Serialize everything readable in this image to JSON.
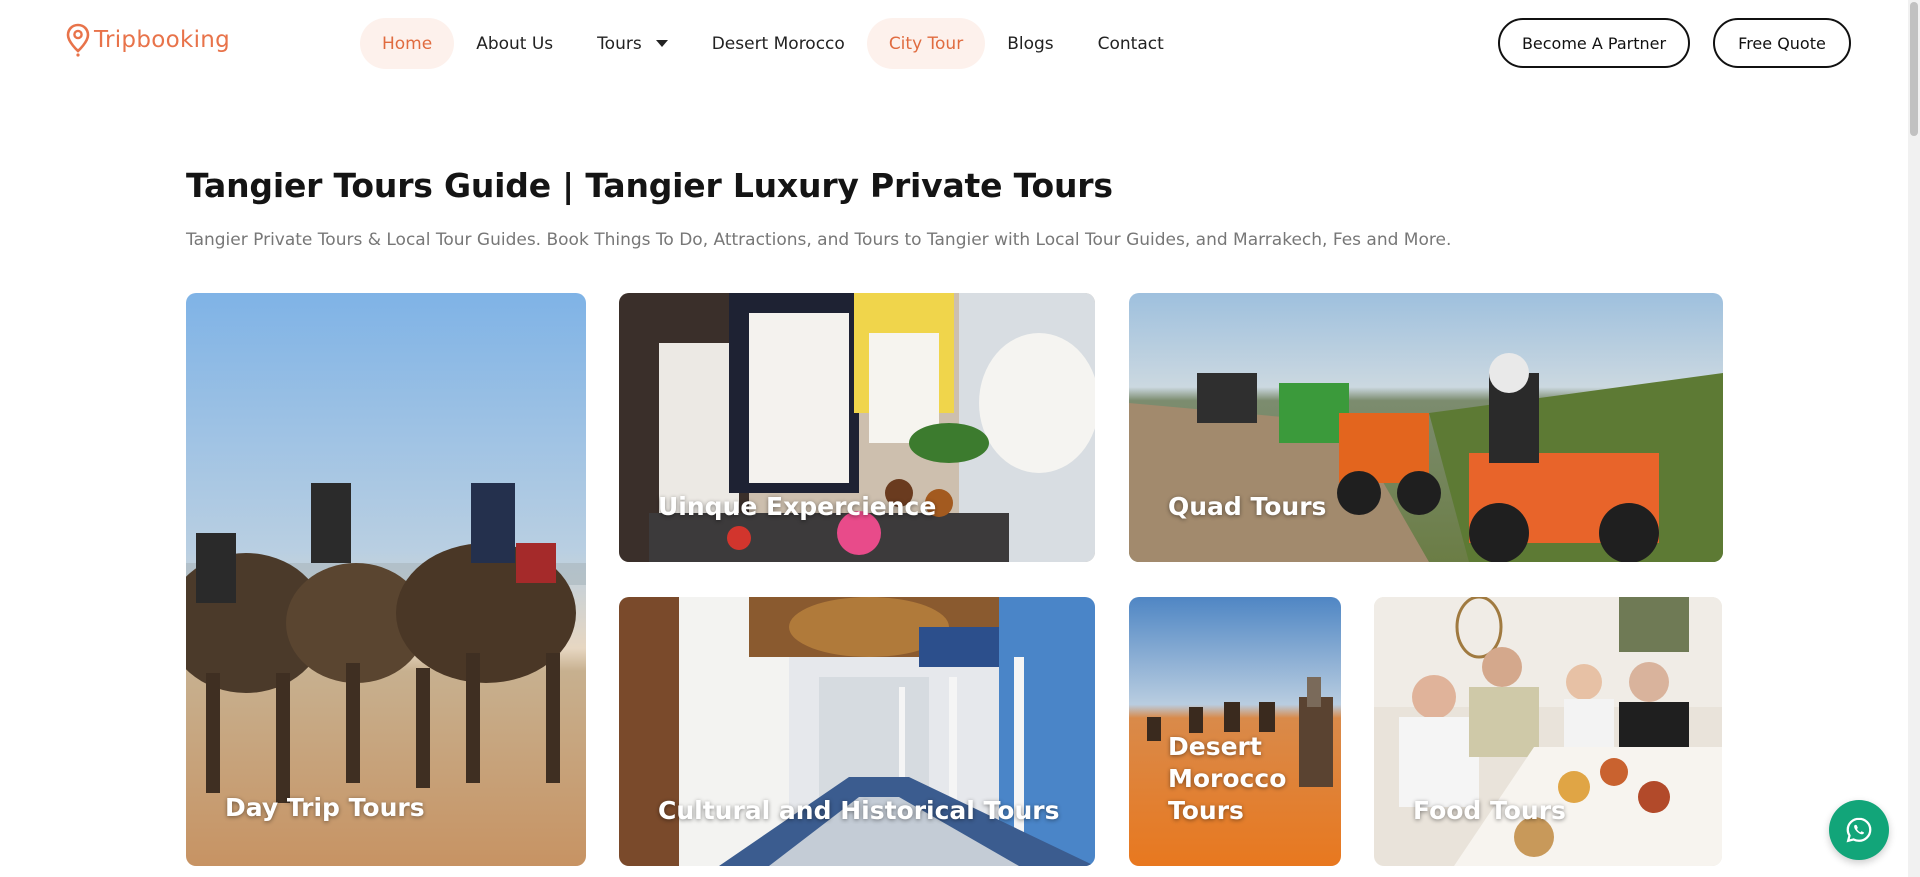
{
  "brand": {
    "name": "Tripbooking",
    "accent": "#e8734a"
  },
  "nav": {
    "items": [
      {
        "label": "Home",
        "active": true
      },
      {
        "label": "About Us",
        "active": false
      },
      {
        "label": "Tours",
        "active": false,
        "has_dropdown": true
      },
      {
        "label": "Desert Morocco",
        "active": false
      },
      {
        "label": "City Tour",
        "active": true
      },
      {
        "label": "Blogs",
        "active": false
      },
      {
        "label": "Contact",
        "active": false
      }
    ]
  },
  "actions": {
    "partner_label": "Become A Partner",
    "quote_label": "Free Quote"
  },
  "page": {
    "title": "Tangier Tours Guide | Tangier Luxury Private Tours",
    "subtitle": "Tangier Private Tours & Local Tour Guides. Book Things To Do, Attractions, and Tours to Tangier with Local Tour Guides, and Marrakech, Fes and More."
  },
  "cards": {
    "day_trip": "Day Trip Tours",
    "unique": "Uinque Expercience",
    "quad": "Quad Tours",
    "cultural": "Cultural and Historical Tours",
    "desert": "Desert Morocco Tours",
    "food": "Food Tours"
  },
  "widgets": {
    "whatsapp_color": "#12a579",
    "whatsapp_icon": "whatsapp-icon"
  }
}
